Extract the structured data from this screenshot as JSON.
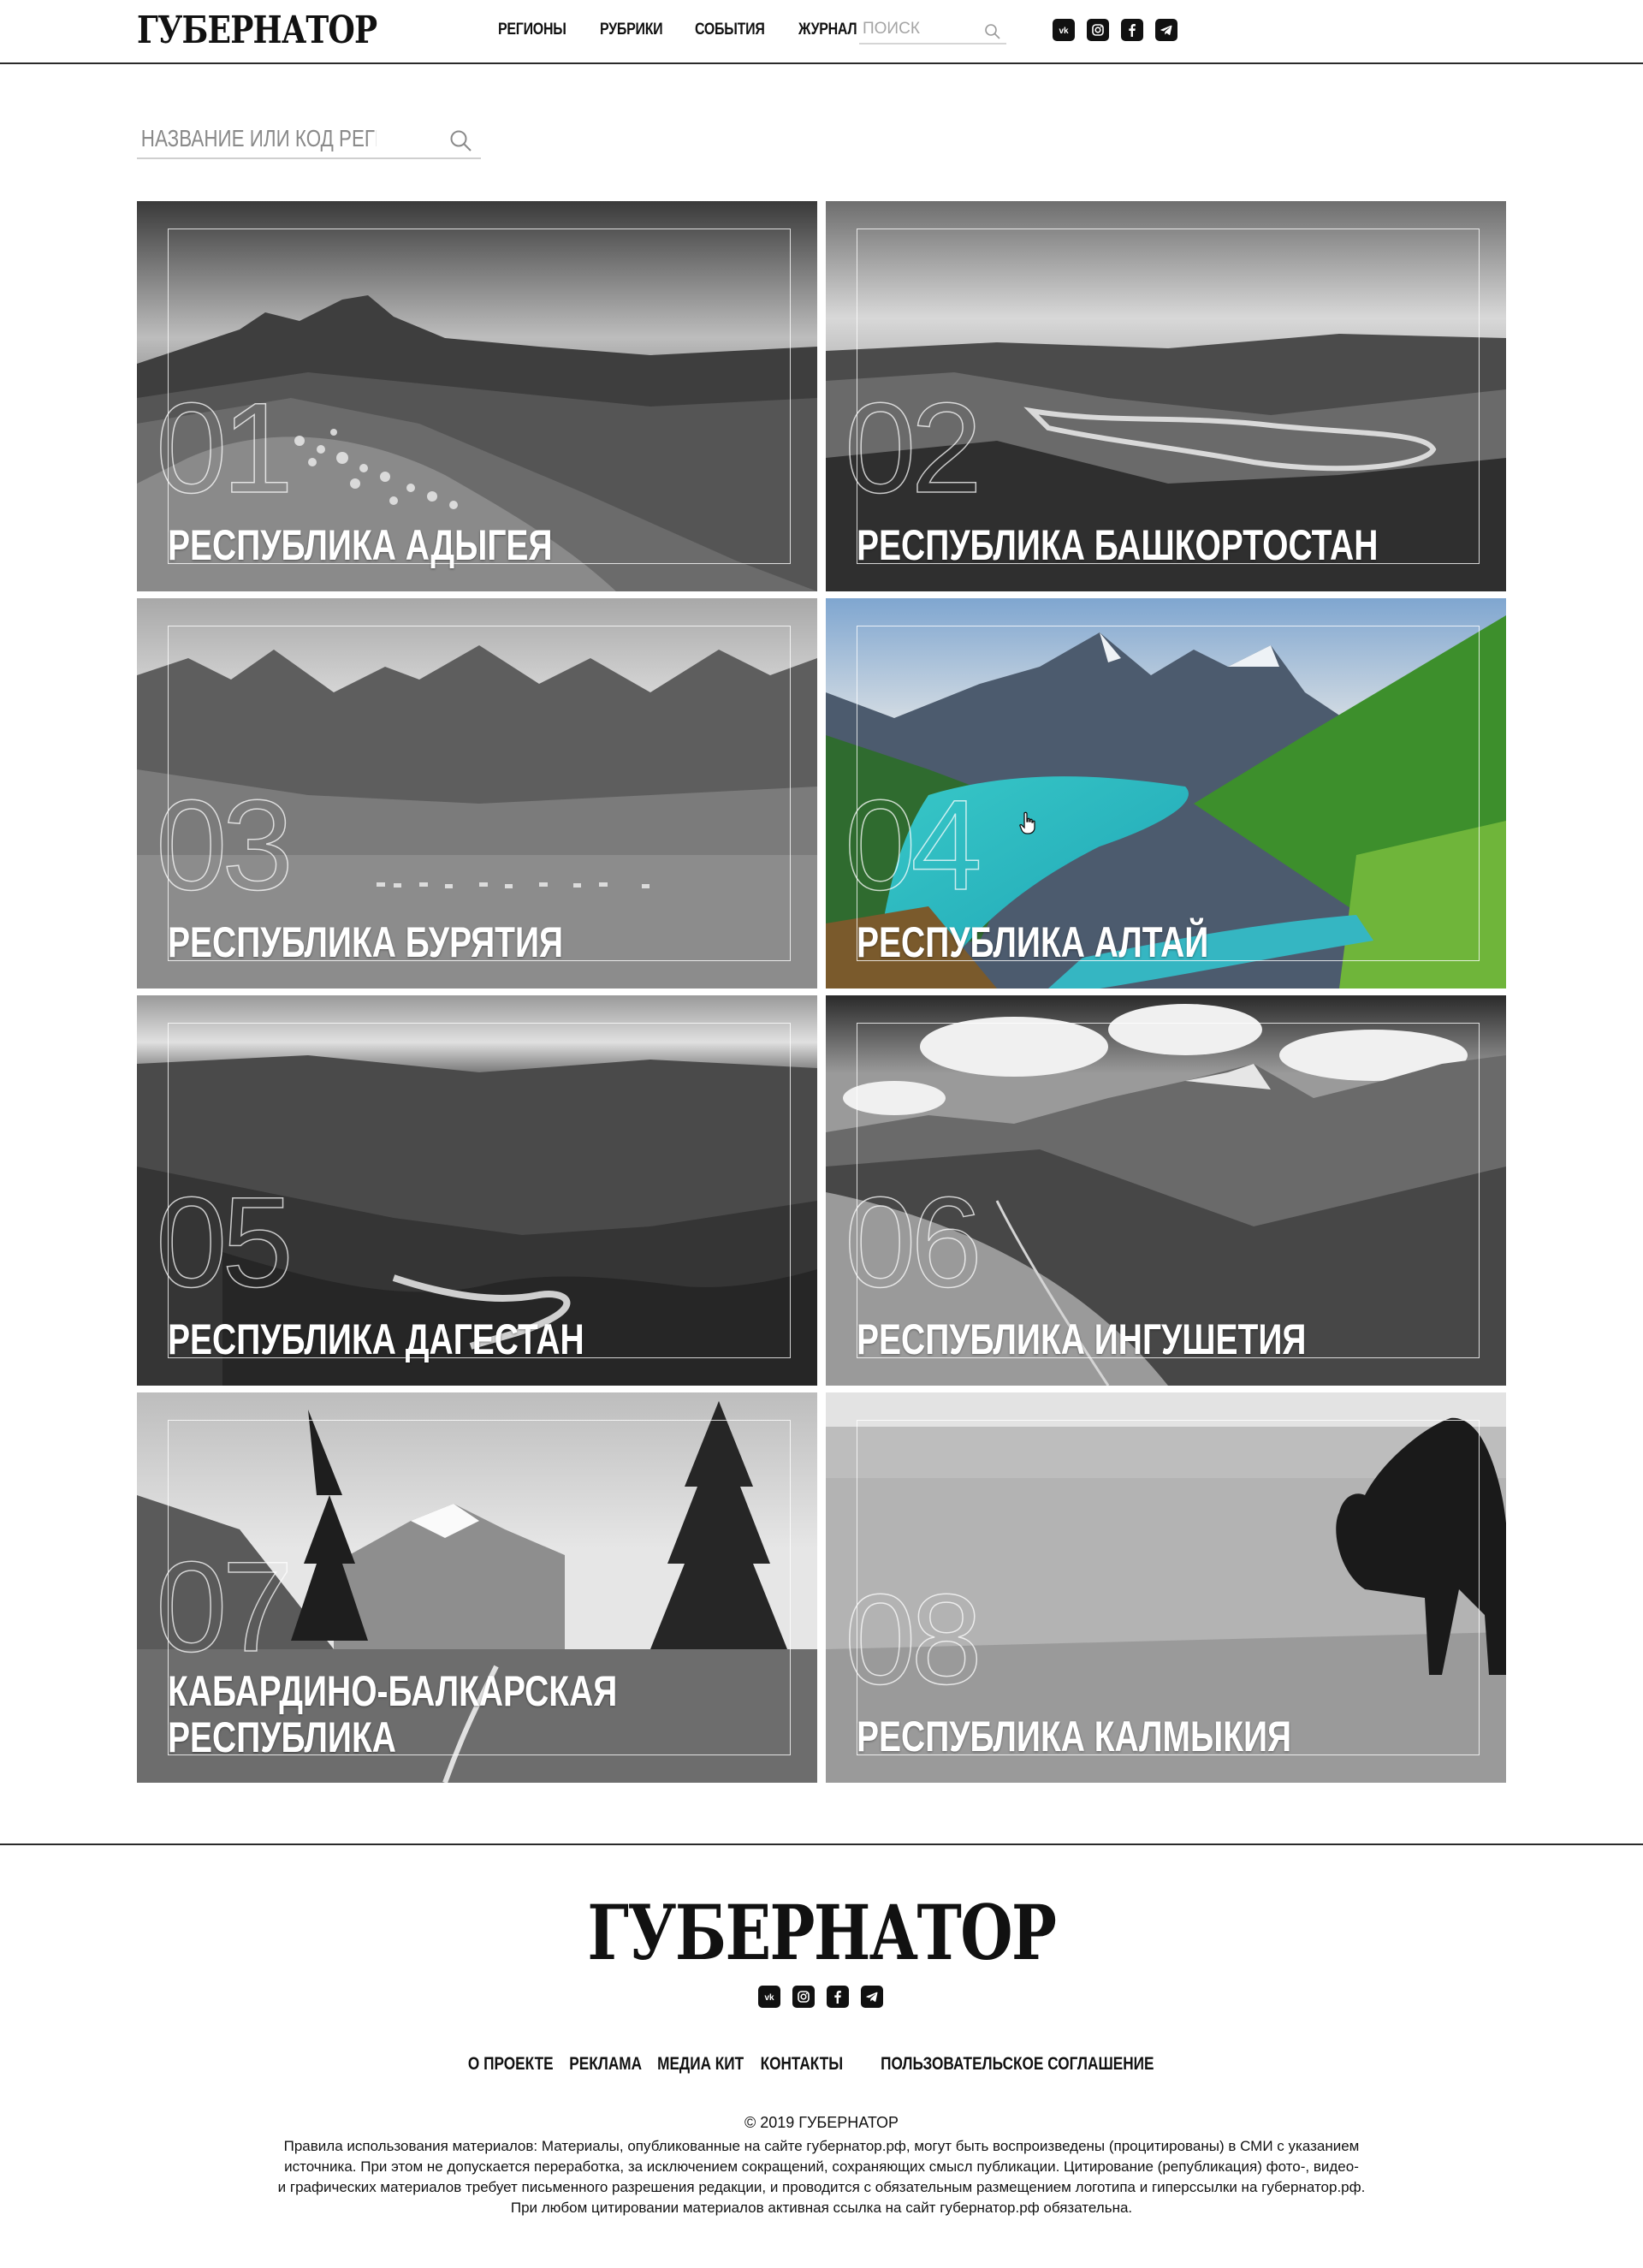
{
  "header": {
    "logo": "ГУБЕРНАТОР",
    "nav": [
      {
        "label": "РЕГИОНЫ"
      },
      {
        "label": "РУБРИКИ"
      },
      {
        "label": "СОБЫТИЯ"
      },
      {
        "label": "ЖУРНАЛ"
      }
    ],
    "search_placeholder": "ПОИСК",
    "social_icons": [
      "vk-icon",
      "instagram-icon",
      "facebook-icon",
      "telegram-icon"
    ]
  },
  "region_search": {
    "placeholder": "НАЗВАНИЕ ИЛИ КОД РЕГИОНА"
  },
  "regions": [
    {
      "code": "01",
      "name": "РЕСПУБЛИКА АДЫГЕЯ",
      "style": "grayscale"
    },
    {
      "code": "02",
      "name": "РЕСПУБЛИКА БАШКОРТОСТАН",
      "style": "grayscale"
    },
    {
      "code": "03",
      "name": "РЕСПУБЛИКА БУРЯТИЯ",
      "style": "grayscale"
    },
    {
      "code": "04",
      "name": "РЕСПУБЛИКА АЛТАЙ",
      "style": "color"
    },
    {
      "code": "05",
      "name": "РЕСПУБЛИКА ДАГЕСТАН",
      "style": "grayscale"
    },
    {
      "code": "06",
      "name": "РЕСПУБЛИКА ИНГУШЕТИЯ",
      "style": "grayscale"
    },
    {
      "code": "07",
      "name": "КАБАРДИНО-БАЛКАРСКАЯ РЕСПУБЛИКА",
      "style": "grayscale"
    },
    {
      "code": "08",
      "name": "РЕСПУБЛИКА КАЛМЫКИЯ",
      "style": "grayscale"
    }
  ],
  "footer": {
    "logo": "ГУБЕРНАТОР",
    "nav": [
      {
        "label": "О ПРОЕКТЕ"
      },
      {
        "label": "РЕКЛАМА"
      },
      {
        "label": "МЕДИА КИТ"
      },
      {
        "label": "КОНТАКТЫ"
      },
      {
        "label": "ПОЛЬЗОВАТЕЛЬСКОЕ СОГЛАШЕНИЕ"
      }
    ],
    "copyright": "© 2019 ГУБЕРНАТОР",
    "legal_lines": [
      "Правила использования материалов: Материалы, опубликованные на сайте губернатор.рф, могут быть воспроизведены (процитированы) в СМИ с указанием",
      "источника. При этом не допускается переработка, за исключением сокращений, сохраняющих смысл публикации. Цитирование (републикация) фото-, видео-",
      "и графических материалов требует письменного разрешения редакции, и проводится с обязательным размещением логотипа и гиперссылки на губернатор.рф.",
      "При любом цитировании материалов активная ссылка на сайт губернатор.рф обязательна."
    ]
  }
}
